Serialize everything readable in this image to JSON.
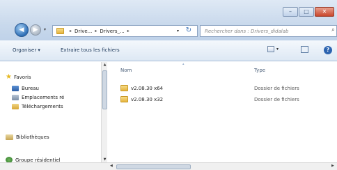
{
  "window": {
    "buttons": {
      "minimize": "–",
      "maximize": "□",
      "close": "✕"
    }
  },
  "address": {
    "crumb1": "Drive...",
    "crumb2": "Drivers_...",
    "sep": "▸",
    "dropdown": "▾",
    "refresh": "↻"
  },
  "search": {
    "placeholder": "Rechercher dans : Drivers_didalab",
    "icon": "⌕"
  },
  "toolbar": {
    "organize": "Organiser ▾",
    "extract_all": "Extraire tous les fichiers",
    "views_caret": "▾",
    "help": "?"
  },
  "sidebar": {
    "favorites": "Favoris",
    "desktop": "Bureau",
    "recent_places": "Emplacements ré",
    "downloads": "Téléchargements",
    "libraries": "Bibliothèques",
    "homegroup": "Groupe résidentiel"
  },
  "columns": {
    "name": "Nom",
    "type": "Type",
    "sort_arrow": "▴"
  },
  "files": [
    {
      "name": "v2.08.30 x64",
      "type": "Dossier de fichiers"
    },
    {
      "name": "v2.08.30 x32",
      "type": "Dossier de fichiers"
    }
  ],
  "scroll": {
    "up": "▲",
    "down": "▼",
    "left": "◀",
    "right": "▶"
  }
}
